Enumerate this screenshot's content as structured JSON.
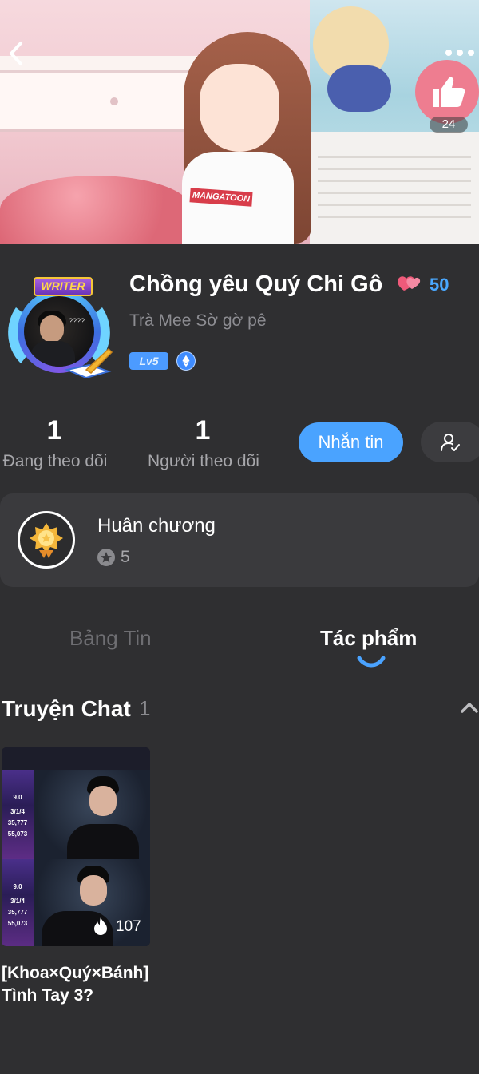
{
  "banner": {
    "shirt_text": "MANGATOON",
    "like_count": "24"
  },
  "profile": {
    "frame_badge": "WRITER",
    "avatar_text": "????",
    "name": "Chồng yêu Quý Chi Gô",
    "heart_count": "50",
    "handle": "Trà Mee Sờ gờ pê",
    "level": "Lv5"
  },
  "stats": {
    "following_count": "1",
    "following_label": "Đang theo dõi",
    "followers_count": "1",
    "followers_label": "Người theo dõi",
    "message_button": "Nhắn tin"
  },
  "medal": {
    "title": "Huân chương",
    "count": "5"
  },
  "tabs": [
    {
      "label": "Bảng Tin",
      "active": false
    },
    {
      "label": "Tác phẩm",
      "active": true
    }
  ],
  "section": {
    "title": "Truyện Chat",
    "count": "1"
  },
  "story": {
    "cover_stats": [
      "9.0",
      "3/1/4",
      "35,777",
      "55,073"
    ],
    "reads": "107",
    "title_line1": "[Khoa×Quý×Bánh]",
    "title_line2": "Tình Tay 3?"
  },
  "colors": {
    "accent": "#4aa3ff",
    "background": "#2f2f31",
    "card": "#3a3a3d"
  }
}
